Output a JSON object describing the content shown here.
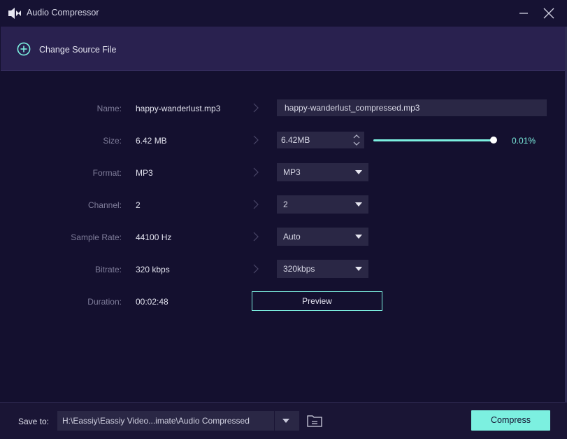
{
  "window": {
    "title": "Audio Compressor"
  },
  "source": {
    "label": "Change Source File"
  },
  "fields": {
    "name": {
      "label": "Name:",
      "value": "happy-wanderlust.mp3",
      "output": "happy-wanderlust_compressed.mp3"
    },
    "size": {
      "label": "Size:",
      "value": "6.42 MB",
      "output": "6.42MB",
      "percent": "0.01%",
      "slider_fraction": 0.97
    },
    "format": {
      "label": "Format:",
      "value": "MP3",
      "output": "MP3"
    },
    "channel": {
      "label": "Channel:",
      "value": "2",
      "output": "2"
    },
    "sample_rate": {
      "label": "Sample Rate:",
      "value": "44100 Hz",
      "output": "Auto"
    },
    "bitrate": {
      "label": "Bitrate:",
      "value": "320 kbps",
      "output": "320kbps"
    },
    "duration": {
      "label": "Duration:",
      "value": "00:02:48"
    }
  },
  "preview": {
    "label": "Preview"
  },
  "save": {
    "label": "Save to:",
    "path": "H:\\Eassiy\\Eassiy Video...imate\\Audio Compressed"
  },
  "compress": {
    "label": "Compress"
  },
  "colors": {
    "accent": "#7cf0e0",
    "background": "#14102f",
    "panel": "#29214f",
    "field": "#2a2745"
  },
  "icons": [
    "audio-compressor-icon",
    "minimize-icon",
    "close-icon",
    "add-circle-icon",
    "chevron-right-icon",
    "spin-up-icon",
    "spin-down-icon",
    "caret-down-icon",
    "folder-icon"
  ]
}
